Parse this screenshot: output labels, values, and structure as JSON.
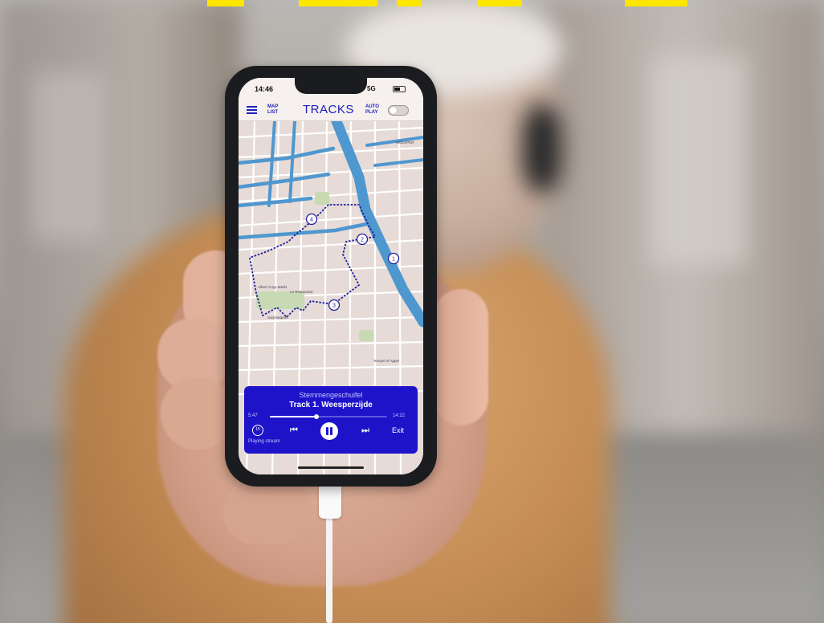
{
  "status_bar": {
    "time": "14:46",
    "signal": "5G"
  },
  "app_bar": {
    "map_list_label": "MAP\nLIST",
    "title": "TRACKS",
    "auto_play_label": "AUTO\nPLAY",
    "auto_play_on": false
  },
  "map": {
    "stops": [
      "1",
      "2",
      "3",
      "4"
    ],
    "labels": [
      "WEESPER",
      "Albert Cuyp Markt",
      "Le Restaurant",
      "Tempel of Appel",
      "Sarphatipark"
    ],
    "colors": {
      "route": "#1e1e9e",
      "water": "#4f97cf",
      "park": "#c8dab3",
      "block": "#e9ddd8"
    }
  },
  "player": {
    "artist": "Stemmengeschuifel",
    "track": "Track 1. Weesperzijde",
    "elapsed": "5:47",
    "duration": "14:22",
    "progress": 0.4,
    "replay_label": "15",
    "status": "Playing stream",
    "exit_label": "Exit",
    "accent_color": "#1e13c9"
  }
}
